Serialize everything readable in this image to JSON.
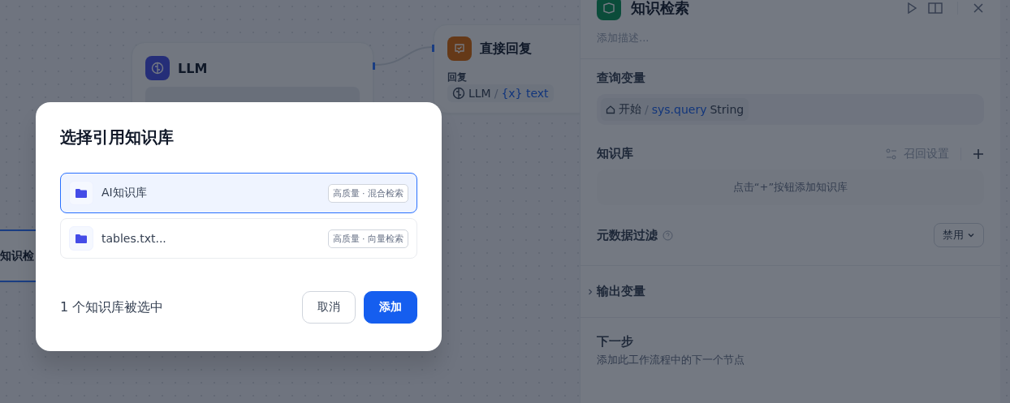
{
  "canvas": {
    "nodes": [
      {
        "kind": "llm",
        "title": "LLM"
      },
      {
        "kind": "answer",
        "title": "直接回复",
        "field_label": "回复",
        "source": "LLM",
        "separator": "/",
        "variable_mark": "{x}",
        "variable": "text"
      },
      {
        "kind": "knowledge",
        "title": "知识检",
        "selected": true
      }
    ]
  },
  "panel": {
    "title": "知识检索",
    "description_placeholder": "添加描述...",
    "query": {
      "label": "查询变量",
      "source": "开始",
      "separator": "/",
      "variable": "sys.query",
      "type": "String"
    },
    "knowledge": {
      "label": "知识库",
      "recall_settings": "召回设置",
      "empty_hint": "点击“+”按钮添加知识库"
    },
    "metadata_filter": {
      "label": "元数据过滤",
      "value": "禁用"
    },
    "output": {
      "label": "输出变量",
      "expanded": false
    },
    "next_step": {
      "label": "下一步",
      "hint": "添加此工作流程中的下一个节点"
    }
  },
  "dialog": {
    "title": "选择引用知识库",
    "items": [
      {
        "name": "AI知识库",
        "tag": "高质量 · 混合检索",
        "selected": true
      },
      {
        "name": "tables.txt...",
        "tag": "高质量 · 向量检索",
        "selected": false
      }
    ],
    "status": "1 个知识库被选中",
    "cancel": "取消",
    "confirm": "添加"
  }
}
